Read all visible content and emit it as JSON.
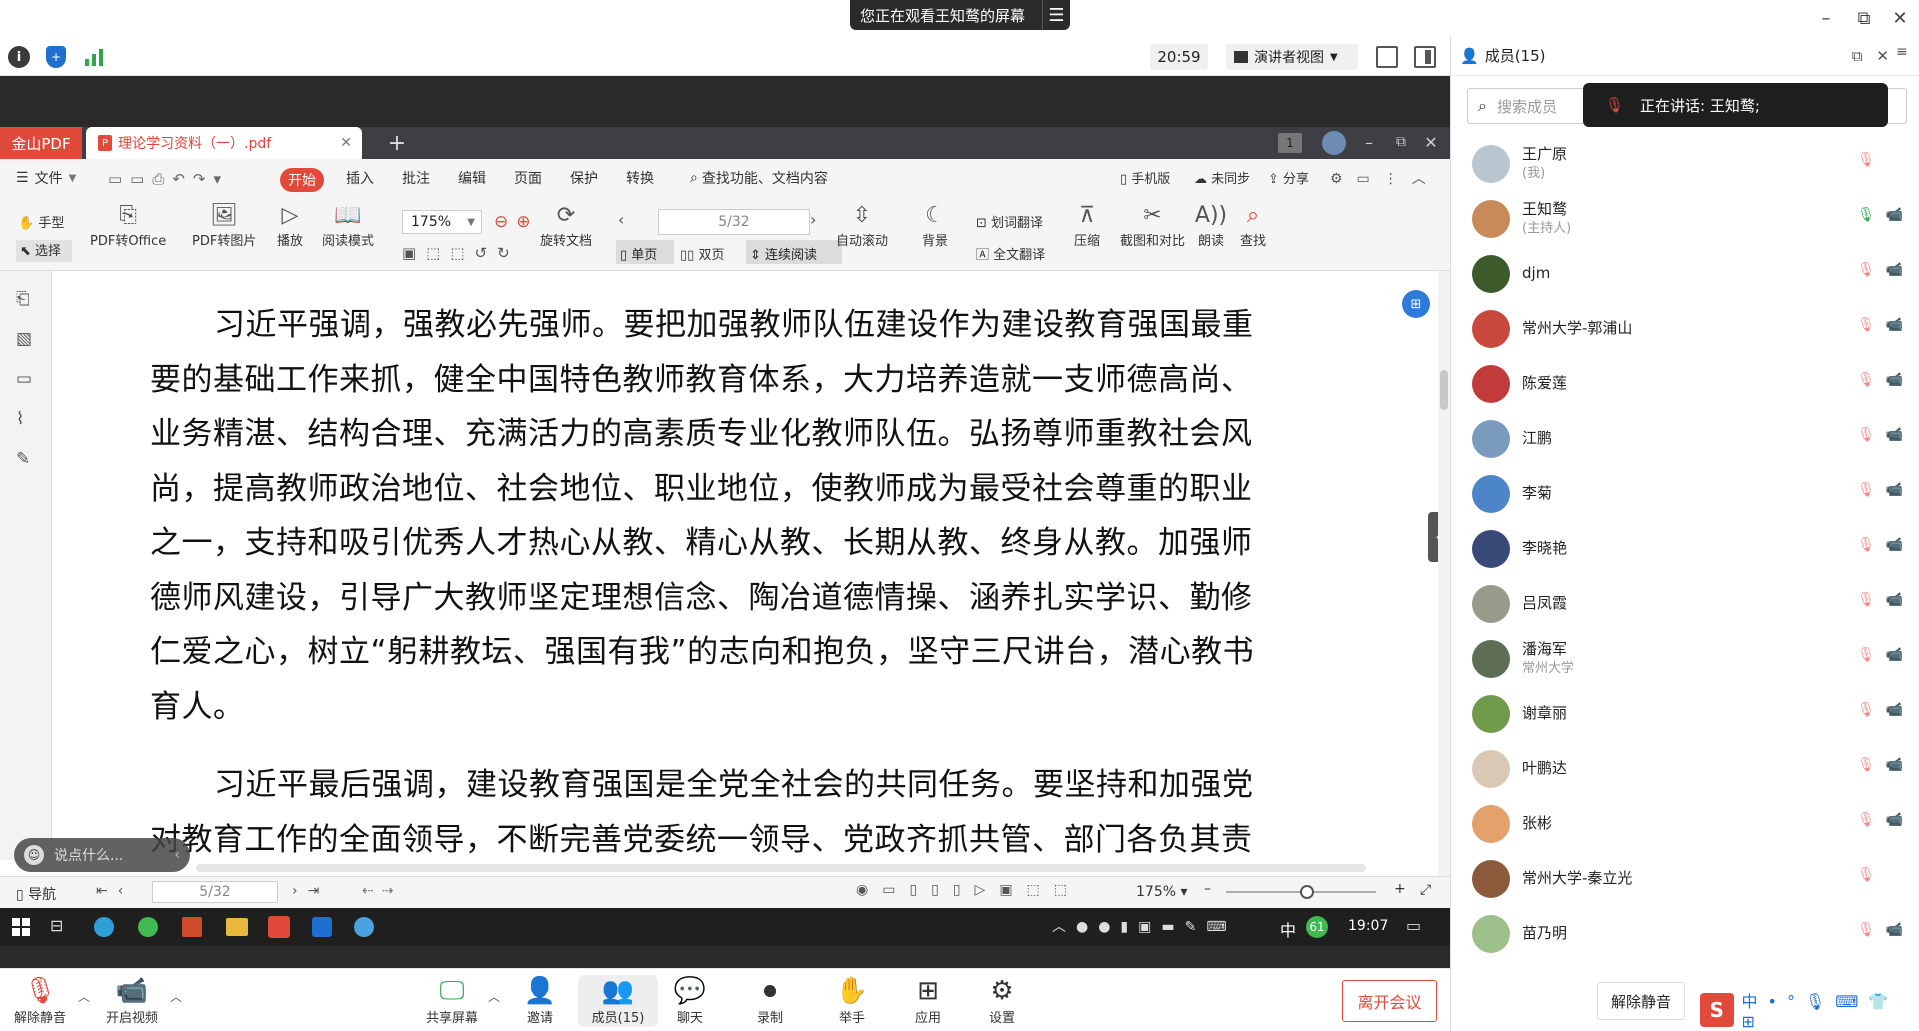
{
  "banner": {
    "text": "您正在观看王知鹜的屏幕",
    "menu_icon": "menu-icon"
  },
  "window_controls": {
    "minimize": "–",
    "restore": "⧉",
    "close": "✕"
  },
  "meeting_toolbar": {
    "clock": "20:59",
    "presenter_view": "演讲者视图"
  },
  "pdf": {
    "app_tab": "金山PDF",
    "doc_tab": "理论学习资料（一）.pdf",
    "menus": [
      "文件",
      "开始",
      "插入",
      "批注",
      "编辑",
      "页面",
      "保护",
      "转换"
    ],
    "search_hint": "查找功能、文档内容",
    "right_menus": [
      "手机版",
      "未同步",
      "分享"
    ],
    "tools": {
      "hand": "手型",
      "select": "选择",
      "pdf_to_office": "PDF转Office",
      "pdf_to_image": "PDF转图片",
      "play": "播放",
      "read_mode": "阅读模式",
      "rotate": "旋转文档",
      "single": "单页",
      "double": "双页",
      "continuous": "连续阅读",
      "auto_scroll": "自动滚动",
      "background": "背景",
      "word_translate": "划词翻译",
      "full_translate": "全文翻译",
      "compress": "压缩",
      "screenshot": "截图和对比",
      "read_aloud": "朗读",
      "find": "查找"
    },
    "zoom": "175%",
    "page": "5/32",
    "paragraphs": [
      "习近平强调，强教必先强师。要把加强教师队伍建设作为建设教育强国最重要的基础工作来抓，健全中国特色教师教育体系，大力培养造就一支师德高尚、业务精湛、结构合理、充满活力的高素质专业化教师队伍。弘扬尊师重教社会风尚，提高教师政治地位、社会地位、职业地位，使教师成为最受社会尊重的职业之一，支持和吸引优秀人才热心从教、精心从教、长期从教、终身从教。加强师德师风建设，引导广大教师坚定理想信念、陶冶道德情操、涵养扎实学识、勤修仁爱之心，树立“躬耕教坛、强国有我”的志向和抱负，坚守三尺讲台，潜心教书育人。",
      "习近平最后强调，建设教育强国是全党全社会的共同任务。要坚持和加强党对教育工作的全面领导，不断完善党委统一领导、党政齐抓共管、部门各负其责"
    ],
    "status": {
      "nav": "导航",
      "page": "5/32",
      "zoom": "175%"
    },
    "chat_hint": "说点什么...",
    "taskbar": {
      "ime": "中",
      "badge": "61",
      "time": "19:07"
    }
  },
  "bottom_bar": {
    "unmute": "解除静音",
    "video": "开启视频",
    "share": "共享屏幕",
    "invite": "邀请",
    "members": "成员(15)",
    "chat": "聊天",
    "record": "录制",
    "raise": "举手",
    "apps": "应用",
    "settings": "设置",
    "leave": "离开会议"
  },
  "panel": {
    "title": "成员(15)",
    "search_placeholder": "搜索成员",
    "speaking": "正在讲话: 王知鹜;",
    "unmute_all": "解除静音",
    "members": [
      {
        "name": "王广原",
        "sub": "(我)",
        "color": "#b9c6cf"
      },
      {
        "name": "王知鹜",
        "sub": "(主持人)",
        "color": "#c98a5a"
      },
      {
        "name": "djm",
        "sub": "",
        "color": "#3d5a2a"
      },
      {
        "name": "常州大学-郭浦山",
        "sub": "",
        "color": "#c9483e"
      },
      {
        "name": "陈爱莲",
        "sub": "",
        "color": "#c23b3b"
      },
      {
        "name": "江鹏",
        "sub": "",
        "color": "#7a9bbd"
      },
      {
        "name": "李菊",
        "sub": "",
        "color": "#4c86c9"
      },
      {
        "name": "李晓艳",
        "sub": "",
        "color": "#3a4a78"
      },
      {
        "name": "吕凤霞",
        "sub": "",
        "color": "#9a9a8a"
      },
      {
        "name": "潘海军",
        "sub": "常州大学",
        "color": "#5d6e55"
      },
      {
        "name": "谢章丽",
        "sub": "",
        "color": "#6f9a4a"
      },
      {
        "name": "叶鹏达",
        "sub": "",
        "color": "#d9c9b4"
      },
      {
        "name": "张彬",
        "sub": "",
        "color": "#e3a26b"
      },
      {
        "name": "常州大学-秦立光",
        "sub": "",
        "color": "#8a5a3a"
      },
      {
        "name": "苗乃明",
        "sub": "",
        "color": "#9dc08a"
      }
    ]
  }
}
